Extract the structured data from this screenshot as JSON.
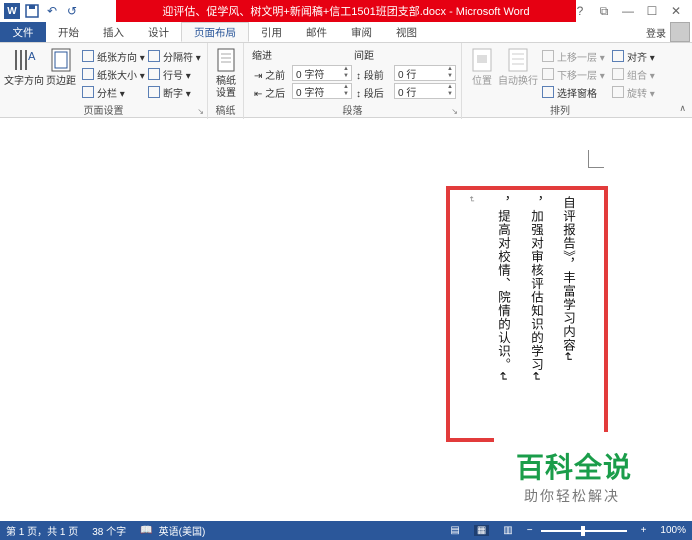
{
  "window": {
    "title": "迎评估、促学风、树文明+新闻稿+信工1501班团支部.docx - Microsoft Word",
    "controls": [
      "?",
      "⧉",
      "—",
      "☐",
      "✕"
    ]
  },
  "qat": {
    "logo": "W",
    "save": "💾",
    "undo": "↶",
    "redo": "↺"
  },
  "tabs": [
    "文件",
    "开始",
    "插入",
    "设计",
    "页面布局",
    "引用",
    "邮件",
    "审阅",
    "视图"
  ],
  "active_tab": "页面布局",
  "login": "登录",
  "ribbon": {
    "page_setup": {
      "label": "页面设置",
      "text_direction": "文字方向",
      "margins": "页边距",
      "orientation": "纸张方向 ▾",
      "size": "纸张大小 ▾",
      "columns": "分栏 ▾",
      "breaks": "分隔符 ▾",
      "line_numbers": "行号 ▾",
      "hyphenation": "断字 ▾"
    },
    "manuscript": {
      "label": "稿纸",
      "button": "稿纸\n设置"
    },
    "paragraph": {
      "label": "段落",
      "indent_header": "缩进",
      "spacing_header": "间距",
      "left_label": "之前",
      "right_label": "之后",
      "left_value": "0 字符",
      "right_value": "0 字符",
      "before_label": "段前",
      "after_label": "段后",
      "before_value": "0 行",
      "after_value": "0 行"
    },
    "arrange": {
      "label": "排列",
      "position": "位置",
      "wrap_text": "自动换行",
      "bring_forward": "上移一层 ▾",
      "send_backward": "下移一层 ▾",
      "selection_pane": "选择窗格",
      "align": "对齐 ▾",
      "group": "组合 ▾",
      "rotate": "旋转 ▾"
    }
  },
  "document": {
    "columns": [
      "自评报告》，丰富学习内容↵",
      "，加强对审核评估知识的学习↵",
      "，提高对校情、院情的认识。↵",
      "↵"
    ]
  },
  "watermark": {
    "title": "百科全说",
    "subtitle": "助你轻松解决"
  },
  "statusbar": {
    "page": "第 1 页，共 1 页",
    "words": "38 个字",
    "language": "英语(美国)",
    "zoom": "100%"
  }
}
